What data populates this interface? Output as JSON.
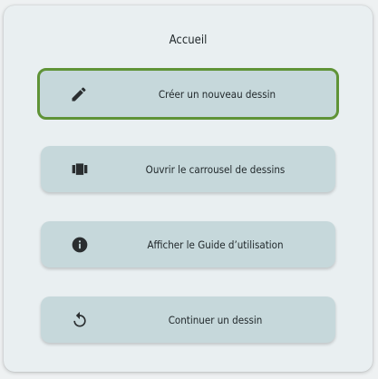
{
  "dialog": {
    "title": "Accueil"
  },
  "menu": {
    "items": [
      {
        "label": "Créer un nouveau dessin",
        "icon": "pencil-icon",
        "selected": true
      },
      {
        "label": "Ouvrir le carrousel de dessins",
        "icon": "carousel-icon",
        "selected": false
      },
      {
        "label": "Afficher le Guide d’utilisation",
        "icon": "info-icon",
        "selected": false
      },
      {
        "label": "Continuer un dessin",
        "icon": "restore-icon",
        "selected": false
      }
    ]
  },
  "colors": {
    "background": "#eef1f2",
    "card": "#e9eff1",
    "button": "#c6d8db",
    "selected_border": "#5f9337",
    "text": "#1f2629"
  }
}
